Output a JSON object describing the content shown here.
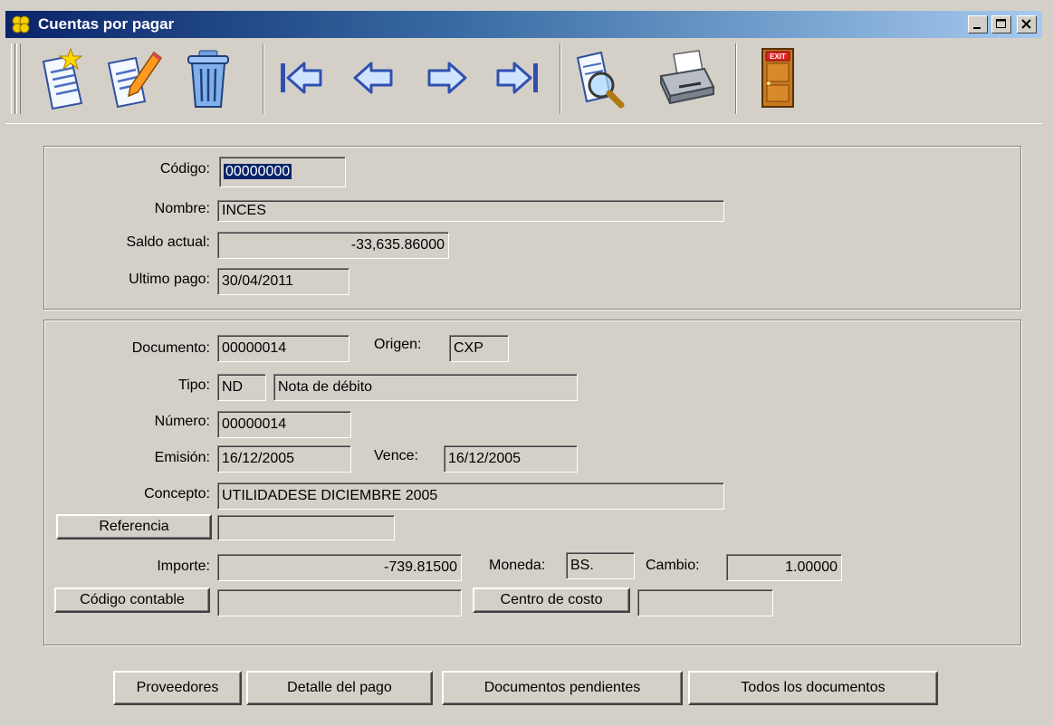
{
  "window": {
    "title": "Cuentas por pagar",
    "icon": "clover-icon",
    "controls": {
      "minimize": "_",
      "maximize": "□",
      "close": "×"
    }
  },
  "toolbar": {
    "buttons": [
      {
        "name": "new-record-button",
        "icon": "new-document-icon"
      },
      {
        "name": "edit-record-button",
        "icon": "edit-document-icon"
      },
      {
        "name": "delete-record-button",
        "icon": "trash-icon"
      },
      {
        "name": "first-record-button",
        "icon": "first-arrow-icon"
      },
      {
        "name": "previous-record-button",
        "icon": "left-arrow-icon"
      },
      {
        "name": "next-record-button",
        "icon": "right-arrow-icon"
      },
      {
        "name": "last-record-button",
        "icon": "last-arrow-icon"
      },
      {
        "name": "search-button",
        "icon": "magnifier-document-icon"
      },
      {
        "name": "print-button",
        "icon": "printer-icon"
      },
      {
        "name": "exit-button",
        "icon": "exit-door-icon",
        "text": "EXIT"
      }
    ]
  },
  "supplier": {
    "codigo_label": "Código:",
    "codigo": "00000000",
    "nombre_label": "Nombre:",
    "nombre": "INCES",
    "saldo_label": "Saldo actual:",
    "saldo": "-33,635.86000",
    "ultimo_pago_label": "Ultimo pago:",
    "ultimo_pago": "30/04/2011"
  },
  "document": {
    "documento_label": "Documento:",
    "documento": "00000014",
    "origen_label": "Origen:",
    "origen": "CXP",
    "tipo_label": "Tipo:",
    "tipo_code": "ND",
    "tipo_desc": "Nota de débito",
    "numero_label": "Número:",
    "numero": "00000014",
    "emision_label": "Emisión:",
    "emision": "16/12/2005",
    "vence_label": "Vence:",
    "vence": "16/12/2005",
    "concepto_label": "Concepto:",
    "concepto": "UTILIDADESE DICIEMBRE 2005",
    "referencia_button": "Referencia",
    "referencia": "",
    "importe_label": "Importe:",
    "importe": "-739.81500",
    "moneda_label": "Moneda:",
    "moneda": "BS.",
    "cambio_label": "Cambio:",
    "cambio": "1.00000",
    "codigo_contable_button": "Código contable",
    "codigo_contable": "",
    "centro_costo_button": "Centro de costo",
    "centro_costo": ""
  },
  "bottom_buttons": {
    "proveedores": "Proveedores",
    "detalle_pago": "Detalle del pago",
    "documentos_pendientes": "Documentos pendientes",
    "todos_documentos": "Todos los documentos"
  }
}
